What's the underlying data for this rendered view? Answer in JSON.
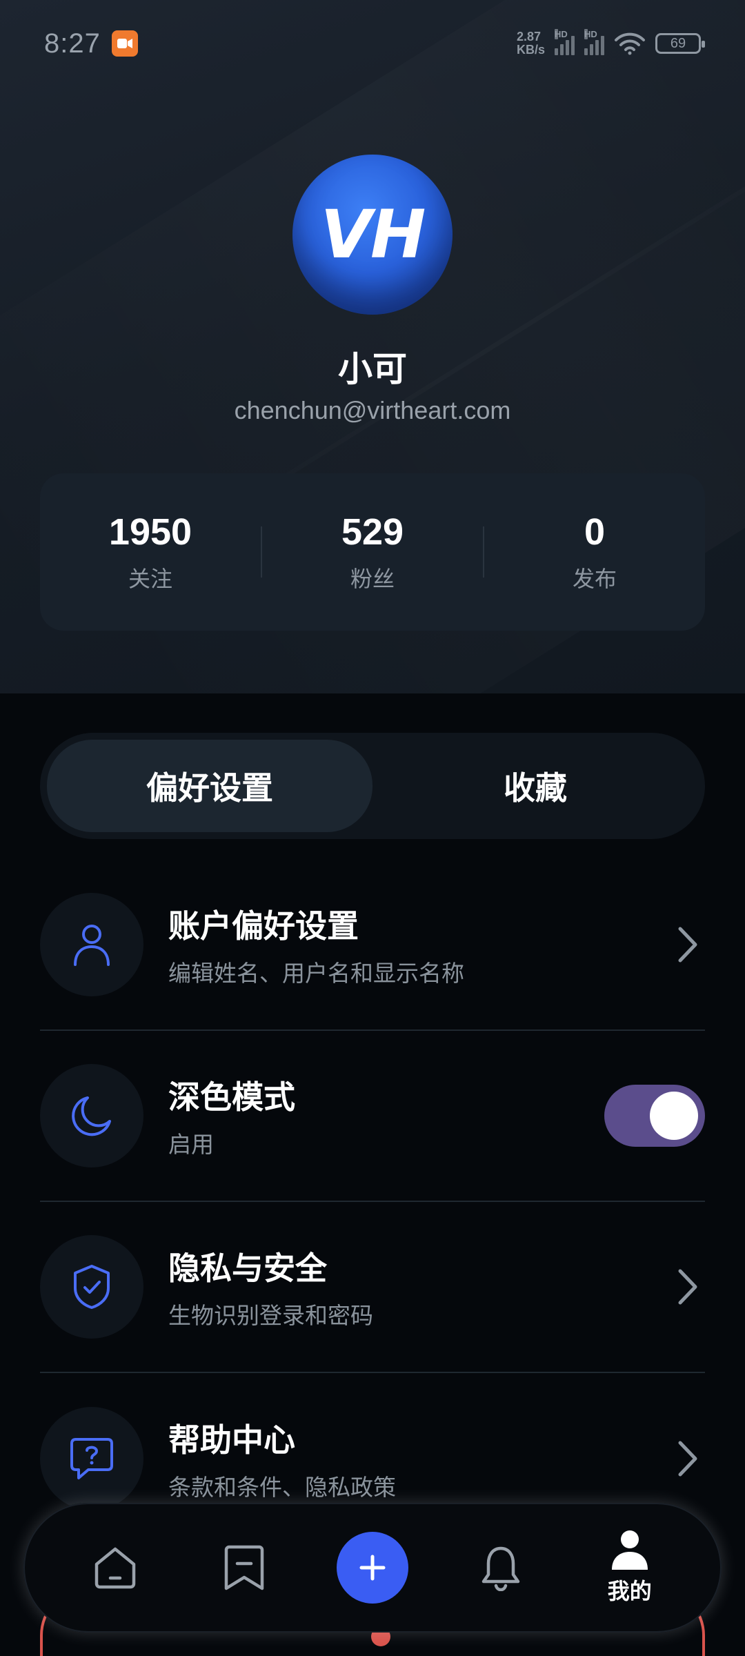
{
  "status_bar": {
    "time": "8:27",
    "net_speed_value": "2.87",
    "net_speed_unit": "KB/s",
    "signal_1_label": "HD",
    "signal_2_label": "HD",
    "battery": "69"
  },
  "profile": {
    "avatar_initials": "VH",
    "name": "小可",
    "email": "chenchun@virtheart.com"
  },
  "stats": [
    {
      "value": "1950",
      "label": "关注"
    },
    {
      "value": "529",
      "label": "粉丝"
    },
    {
      "value": "0",
      "label": "发布"
    }
  ],
  "tabs": [
    {
      "label": "偏好设置",
      "active": true
    },
    {
      "label": "收藏",
      "active": false
    }
  ],
  "settings": {
    "account": {
      "title": "账户偏好设置",
      "subtitle": "编辑姓名、用户名和显示名称",
      "icon": "user-icon"
    },
    "dark_mode": {
      "title": "深色模式",
      "subtitle": "启用",
      "icon": "moon-icon",
      "enabled": true
    },
    "privacy": {
      "title": "隐私与安全",
      "subtitle": "生物识别登录和密码",
      "icon": "shield-check-icon"
    },
    "help": {
      "title": "帮助中心",
      "subtitle": "条款和条件、隐私政策",
      "icon": "help-chat-icon"
    }
  },
  "bottom_nav": {
    "items": [
      {
        "icon": "home-icon"
      },
      {
        "icon": "bookmark-icon"
      },
      {
        "icon": "plus-icon"
      },
      {
        "icon": "bell-icon"
      },
      {
        "icon": "profile-icon",
        "label": "我的",
        "active": true
      }
    ]
  },
  "colors": {
    "accent_blue": "#3a5df3",
    "toggle_on": "#5b4d8c",
    "icon_blue": "#4a6df5"
  }
}
